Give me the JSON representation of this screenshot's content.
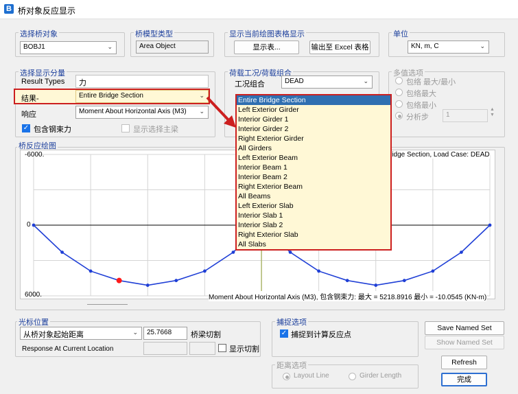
{
  "window": {
    "title": "桥对象反应显示",
    "icon": "B"
  },
  "bridge_object": {
    "label": "选择桥对象",
    "value": "BOBJ1"
  },
  "model_type": {
    "label": "桥模型类型",
    "value": "Area Object"
  },
  "table_display": {
    "label": "显示当前绘图表格显示",
    "show_button": "显示表...",
    "excel_button": "输出至 Excel 表格"
  },
  "units": {
    "label": "单位",
    "value": "KN, m, C"
  },
  "component": {
    "label": "选择显示分量",
    "result_types_label": "Result Types",
    "result_types_value": "力",
    "result_label": "结果-",
    "result_value": "Entire Bridge Section",
    "response_label": "响应",
    "response_value": "Moment About Horizontal Axis  (M3)",
    "include_tendon_label": "包含钢束力",
    "show_girder_label": "显示选择主梁"
  },
  "load_case": {
    "label": "荷载工况/荷载组合",
    "case_label": "工况组合",
    "case_value": "DEAD"
  },
  "multi_values": {
    "label": "多值选项",
    "opt1": "包络 最大/最小",
    "opt2": "包络最大",
    "opt3": "包络最小",
    "opt4": "分析步",
    "step_value": "1"
  },
  "dropdown": {
    "items": [
      "Entire Bridge Section",
      "Left Exterior Girder",
      "Interior Girder 1",
      "Interior Girder 2",
      "Right Exterior Girder",
      "All Girders",
      "Left Exterior Beam",
      "Interior Beam 1",
      "Interior Beam 2",
      "Right Exterior Beam",
      "All Beams",
      "Left Exterior Slab",
      "Interior Slab 1",
      "Interior Slab 2",
      "Right Exterior Slab",
      "All Slabs"
    ]
  },
  "plot": {
    "label": "桥反应绘图",
    "top_label": "-6000.",
    "bottom_label": "6000.",
    "zero_label": "0",
    "header_text": "ridge Section,  Load Case: DEAD",
    "footer_text": "Moment About Horizontal Axis  (M3), 包含钢束力:  最大 = 5218.8916    最小 = -10.0545  (KN-m)"
  },
  "chart_data": {
    "type": "line",
    "series": [
      {
        "values": [
          0,
          2300,
          3900,
          4700,
          5100,
          4700,
          3900,
          2300,
          0,
          2300,
          3900,
          4700,
          5100,
          4700,
          3900,
          2300,
          0
        ]
      }
    ],
    "ylim": [
      -6000,
      6000
    ],
    "y_top_label": "-6000.",
    "y_bottom_label": "6000.",
    "grid": true,
    "marker_index": 3
  },
  "cursor": {
    "label": "光标位置",
    "mode_value": "从桥对象起始距离",
    "distance_value": "25.7668",
    "cut_label": "桥梁切割",
    "response_label": "Response At Current Location",
    "show_cut_label": "显示切割"
  },
  "snap": {
    "label": "捕捉选项",
    "snap_label": "捕捉到计算反应点"
  },
  "distance": {
    "label": "距离选项",
    "opt1": "Layout Line",
    "opt2": "Girder Length"
  },
  "buttons": {
    "save_named": "Save Named Set",
    "show_named": "Show Named Set",
    "refresh": "Refresh",
    "done": "完成"
  },
  "colors": {
    "accent": "#1a73e8",
    "highlight": "#cc1f1f",
    "line": "#1f3fd6",
    "marker": "#ff1a1a",
    "dropdown_bg": "#fff8d6"
  }
}
